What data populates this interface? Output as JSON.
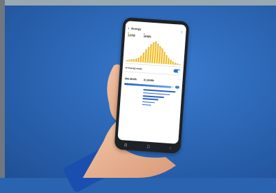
{
  "scene": {
    "description_colors": {
      "background": "#2a63b0",
      "accent": "#2f6fd6",
      "chart_bar": "#f2c12e"
    }
  },
  "phone": {
    "status_bar": {
      "left": "",
      "right": ""
    },
    "header": {
      "back_icon": "arrow-left-icon",
      "title": "Energy",
      "more_icon": "more-vertical-icon"
    },
    "stats": [
      {
        "label": "",
        "value": "137W"
      },
      {
        "label": "",
        "value": "16Wh"
      }
    ],
    "toggle": {
      "title": "AI Energy mode",
      "description": ""
    },
    "usage": {
      "section_title": "",
      "items": [
        {
          "label": "",
          "value": "366.3kWh"
        },
        {
          "label": "",
          "value": "31.8kWh"
        }
      ],
      "progress": 0.95
    },
    "devices": [
      {
        "name": "",
        "value": "",
        "level": 0.9
      },
      {
        "name": "",
        "value": "",
        "level": 0.75
      },
      {
        "name": "",
        "value": "",
        "level": 0.6
      },
      {
        "name": "",
        "value": "",
        "level": 0.45
      },
      {
        "name": "",
        "value": "",
        "level": 0.35
      },
      {
        "name": "",
        "value": "",
        "level": 0.25
      }
    ],
    "chart_bars": [
      0.05,
      0.08,
      0.1,
      0.12,
      0.15,
      0.2,
      0.3,
      0.45,
      0.6,
      0.72,
      0.85,
      0.95,
      1.0,
      0.9,
      0.8,
      0.7,
      0.55,
      0.4,
      0.28,
      0.2,
      0.12,
      0.08,
      0.05,
      0.03
    ]
  }
}
